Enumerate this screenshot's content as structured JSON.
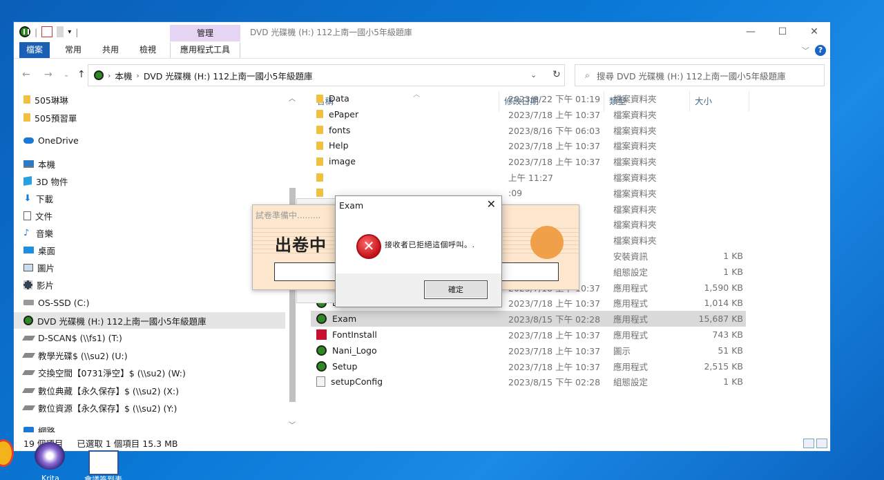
{
  "titlebar": {
    "manage_tab": "管理",
    "title": "DVD 光碟機 (H:) 112上南一國小5年級題庫",
    "min": "—",
    "max": "☐",
    "close": "✕"
  },
  "ribbon": {
    "tabs": [
      "檔案",
      "常用",
      "共用",
      "檢視"
    ],
    "tools_tab": "應用程式工具",
    "help": "?"
  },
  "address": {
    "segments": [
      "本機",
      "DVD 光碟機 (H:) 112上南一國小5年級題庫"
    ],
    "search_placeholder": "搜尋 DVD 光碟機 (H:) 112上南一國小5年級題庫"
  },
  "nav": {
    "items": [
      {
        "label": "505琳琳",
        "icon": "folder-icon"
      },
      {
        "label": "505預習單",
        "icon": "folder-icon"
      },
      {
        "label": "OneDrive",
        "icon": "cloud-icon"
      },
      {
        "label": "本機",
        "icon": "pc-icon"
      },
      {
        "label": "3D 物件",
        "icon": "cube-icon"
      },
      {
        "label": "下載",
        "icon": "download-icon"
      },
      {
        "label": "文件",
        "icon": "document-icon"
      },
      {
        "label": "音樂",
        "icon": "music-icon"
      },
      {
        "label": "桌面",
        "icon": "desktop-icon"
      },
      {
        "label": "圖片",
        "icon": "pictures-icon"
      },
      {
        "label": "影片",
        "icon": "videos-icon"
      },
      {
        "label": "OS-SSD (C:)",
        "icon": "drive-icon"
      },
      {
        "label": "DVD 光碟機 (H:) 112上南一國小5年級題庫",
        "icon": "dvd-icon"
      },
      {
        "label": "D-SCAN$ (\\\\fs1) (T:)",
        "icon": "network-drive-icon"
      },
      {
        "label": "教學光碟$ (\\\\su2) (U:)",
        "icon": "network-drive-icon"
      },
      {
        "label": "交換空間【0731淨空】$ (\\\\su2) (W:)",
        "icon": "network-drive-icon"
      },
      {
        "label": "數位典藏【永久保存】$ (\\\\su2) (X:)",
        "icon": "network-drive-icon"
      },
      {
        "label": "數位資源【永久保存】$ (\\\\su2) (Y:)",
        "icon": "network-drive-icon"
      },
      {
        "label": "網路",
        "icon": "network-icon"
      }
    ]
  },
  "columns": {
    "name": "名稱",
    "date": "修改日期",
    "type": "類型",
    "size": "大小"
  },
  "files": [
    {
      "name": "Data",
      "date": "2023/8/22 下午 01:19",
      "type": "檔案資料夾",
      "size": ""
    },
    {
      "name": "ePaper",
      "date": "2023/7/18 上午 10:37",
      "type": "檔案資料夾",
      "size": ""
    },
    {
      "name": "fonts",
      "date": "2023/8/16 下午 06:03",
      "type": "檔案資料夾",
      "size": ""
    },
    {
      "name": "Help",
      "date": "2023/7/18 上午 10:37",
      "type": "檔案資料夾",
      "size": ""
    },
    {
      "name": "image",
      "date": "2023/7/18 上午 10:37",
      "type": "檔案資料夾",
      "size": ""
    },
    {
      "name": "",
      "date": "上午 11:27",
      "type": "檔案資料夾",
      "size": ""
    },
    {
      "name": "",
      "date": ":09",
      "type": "檔案資料夾",
      "size": ""
    },
    {
      "name": "",
      "date": "37",
      "type": "檔案資料夾",
      "size": ""
    },
    {
      "name": "",
      "date": "27",
      "type": "檔案資料夾",
      "size": ""
    },
    {
      "name": "",
      "date": "37",
      "type": "檔案資料夾",
      "size": ""
    },
    {
      "name": "",
      "date": "37",
      "type": "安裝資訊",
      "size": "1 KB"
    },
    {
      "name": "",
      "date": "上午 11:00",
      "type": "組態設定",
      "size": "1 KB"
    },
    {
      "name": "EAutoRun",
      "date": "2023/7/18 上午 10:37",
      "type": "應用程式",
      "size": "1,590 KB"
    },
    {
      "name": "EExamUL",
      "date": "2023/7/18 上午 10:37",
      "type": "應用程式",
      "size": "1,014 KB"
    },
    {
      "name": "Exam",
      "date": "2023/8/15 下午 02:28",
      "type": "應用程式",
      "size": "15,687 KB"
    },
    {
      "name": "FontInstall",
      "date": "2023/7/18 上午 10:37",
      "type": "應用程式",
      "size": "743 KB"
    },
    {
      "name": "Nani_Logo",
      "date": "2023/7/18 上午 10:37",
      "type": "圖示",
      "size": "51 KB"
    },
    {
      "name": "Setup",
      "date": "2023/7/18 上午 10:37",
      "type": "應用程式",
      "size": "2,515 KB"
    },
    {
      "name": "setupConfig",
      "date": "2023/8/15 下午 02:28",
      "type": "組態設定",
      "size": "1 KB"
    }
  ],
  "status": {
    "count": "19 個項目",
    "selected": "已選取 1 個項目  15.3 MB"
  },
  "prep_window": {
    "title": "試卷準備中.........",
    "heading": "出卷中"
  },
  "dialog": {
    "title": "Exam",
    "message": "接收者已拒絕這個呼叫。.",
    "ok": "確定"
  },
  "desktop": {
    "labels": [
      "Krita",
      "會議簽到表"
    ]
  }
}
